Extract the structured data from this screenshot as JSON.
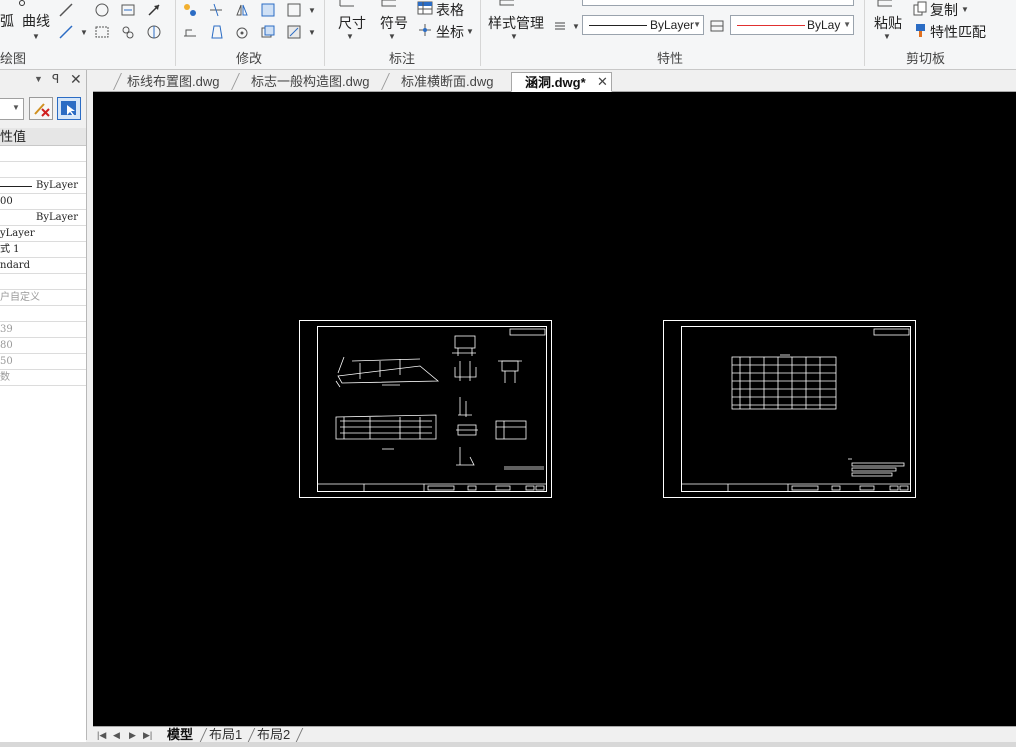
{
  "ribbon": {
    "groups": {
      "draw": {
        "label": "绘图",
        "curve_label": "曲线",
        "arc_partial": "弧"
      },
      "modify": {
        "label": "修改"
      },
      "annotate": {
        "label": "标注",
        "dimension_label": "尺寸",
        "symbol_label": "符号",
        "table_label": "表格",
        "coordinate_label": "坐标"
      },
      "style": {
        "label": "样式管理"
      },
      "properties": {
        "label": "特性",
        "linetype_value": "ByLayer",
        "lineweight_value": "ByLay"
      },
      "clipboard": {
        "label": "剪切板",
        "paste_label": "粘贴",
        "copy_label": "复制",
        "match_label": "特性匹配"
      }
    },
    "colors": {
      "line_red": "#e03030",
      "accent_blue": "#2b6cc4"
    }
  },
  "panel": {
    "header": "性值",
    "rows": [
      {
        "text": ""
      },
      {
        "text": ""
      },
      {
        "text": "ByLayer",
        "line": true
      },
      {
        "text": "00"
      },
      {
        "text": "ByLayer"
      },
      {
        "text": "yLayer"
      },
      {
        "text": "式 1"
      },
      {
        "text": "ndard"
      },
      {
        "text": ""
      },
      {
        "text": "户自定义",
        "gray": true
      },
      {
        "text": ""
      },
      {
        "text": "39",
        "gray": true
      },
      {
        "text": "80",
        "gray": true
      },
      {
        "text": "50",
        "gray": true
      },
      {
        "text": "数",
        "gray": true
      }
    ]
  },
  "doc_tabs": [
    {
      "label": "标线布置图.dwg",
      "active": false
    },
    {
      "label": "标志一般构造图.dwg",
      "active": false
    },
    {
      "label": "标准横断面.dwg",
      "active": false
    },
    {
      "label": "涵洞.dwg*",
      "active": true
    }
  ],
  "layout_tabs": [
    {
      "label": "模型",
      "active": true
    },
    {
      "label": "布局1",
      "active": false
    },
    {
      "label": "布局2",
      "active": false
    }
  ],
  "canvas": {
    "background": "#000000",
    "line_color": "#ffffff"
  }
}
